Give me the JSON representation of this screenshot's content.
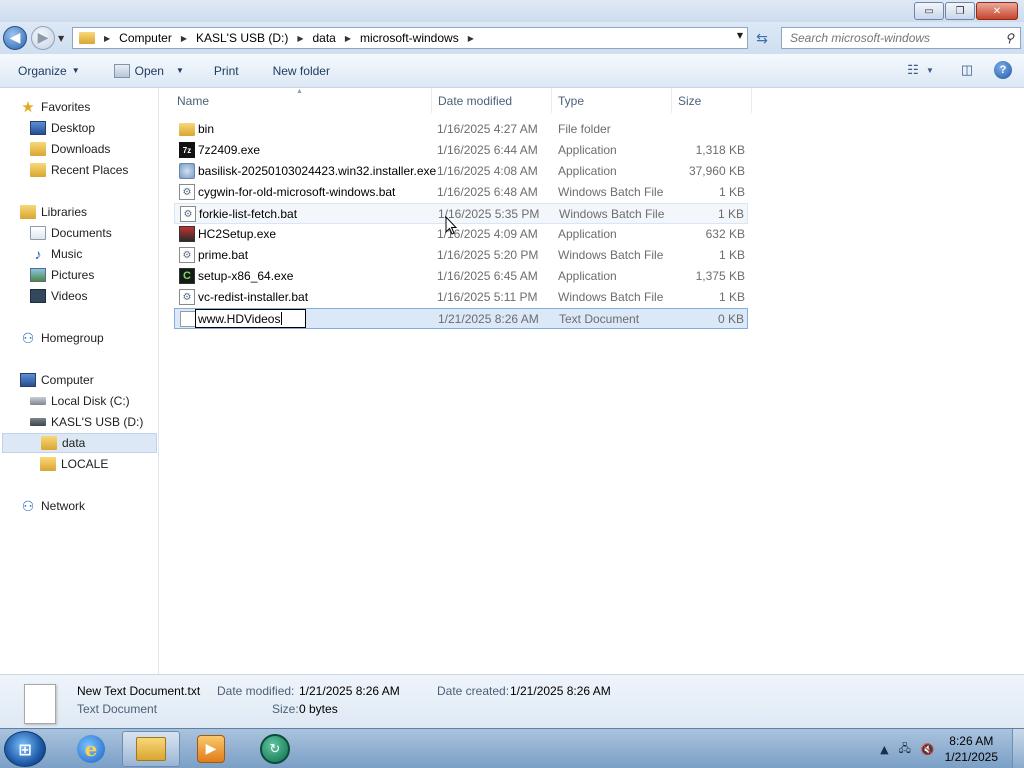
{
  "window": {
    "minimize_glyph": "▭",
    "maximize_glyph": "❐",
    "close_glyph": "✕"
  },
  "address": {
    "crumbs": [
      "Computer",
      "KASL'S USB (D:)",
      "data",
      "microsoft-windows"
    ],
    "search_placeholder": "Search microsoft-windows"
  },
  "toolbar": {
    "organize": "Organize",
    "open": "Open",
    "print": "Print",
    "new_folder": "New folder"
  },
  "nav": {
    "favorites": "Favorites",
    "desktop": "Desktop",
    "downloads": "Downloads",
    "recent_places": "Recent Places",
    "libraries": "Libraries",
    "documents": "Documents",
    "music": "Music",
    "pictures": "Pictures",
    "videos": "Videos",
    "homegroup": "Homegroup",
    "computer": "Computer",
    "local_disk": "Local Disk (C:)",
    "usb": "KASL'S USB (D:)",
    "data": "data",
    "locale": "LOCALE",
    "network": "Network"
  },
  "columns": {
    "name": "Name",
    "date_modified": "Date modified",
    "type": "Type",
    "size": "Size"
  },
  "files": [
    {
      "name": "bin",
      "date": "1/16/2025 4:27 AM",
      "type": "File folder",
      "size": "",
      "icon": "folder-icon"
    },
    {
      "name": "7z2409.exe",
      "date": "1/16/2025 6:44 AM",
      "type": "Application",
      "size": "1,318 KB",
      "icon": "7zip-icon"
    },
    {
      "name": "basilisk-20250103024423.win32.installer.exe",
      "date": "1/16/2025 4:08 AM",
      "type": "Application",
      "size": "37,960 KB",
      "icon": "installer-icon"
    },
    {
      "name": "cygwin-for-old-microsoft-windows.bat",
      "date": "1/16/2025 6:48 AM",
      "type": "Windows Batch File",
      "size": "1 KB",
      "icon": "batch-file-icon"
    },
    {
      "name": "forkie-list-fetch.bat",
      "date": "1/16/2025 5:35 PM",
      "type": "Windows Batch File",
      "size": "1 KB",
      "icon": "batch-file-icon"
    },
    {
      "name": "HC2Setup.exe",
      "date": "1/16/2025 4:09 AM",
      "type": "Application",
      "size": "632 KB",
      "icon": "hc2-setup-icon"
    },
    {
      "name": "prime.bat",
      "date": "1/16/2025 5:20 PM",
      "type": "Windows Batch File",
      "size": "1 KB",
      "icon": "batch-file-icon"
    },
    {
      "name": "setup-x86_64.exe",
      "date": "1/16/2025 6:45 AM",
      "type": "Application",
      "size": "1,375 KB",
      "icon": "cygwin-setup-icon"
    },
    {
      "name": "vc-redist-installer.bat",
      "date": "1/16/2025 5:11 PM",
      "type": "Windows Batch File",
      "size": "1 KB",
      "icon": "batch-file-icon"
    }
  ],
  "renaming": {
    "value": "www.HDVideos",
    "date": "1/21/2025 8:26 AM",
    "type": "Text Document",
    "size": "0 KB"
  },
  "details": {
    "filename": "New Text Document.txt",
    "filetype": "Text Document",
    "date_modified_label": "Date modified:",
    "date_modified": "1/21/2025 8:26 AM",
    "date_created_label": "Date created:",
    "date_created": "1/21/2025 8:26 AM",
    "size_label": "Size:",
    "size": "0 bytes"
  },
  "taskbar": {
    "time": "8:26 AM",
    "date": "1/21/2025"
  }
}
